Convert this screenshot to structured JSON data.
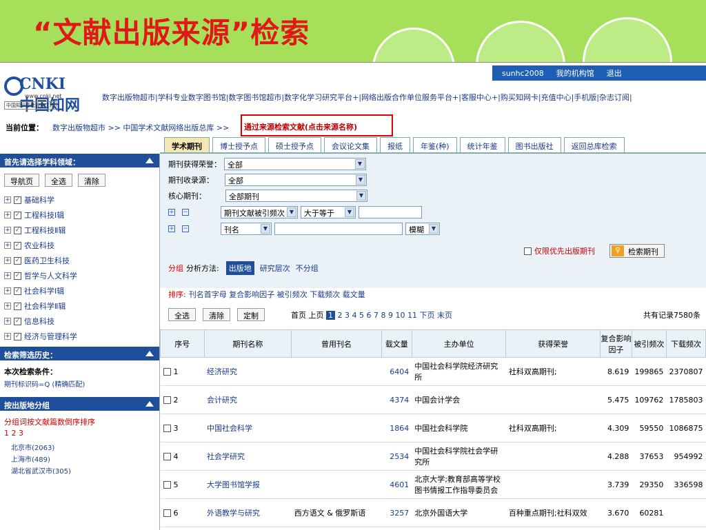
{
  "slide_title": "“文献出版来源”检索",
  "user_bar": {
    "user": "sunhc2008",
    "my_org": "我的机构馆",
    "logout": "退出"
  },
  "logo": {
    "brand": "CNKI中国知网",
    "url": "www.cnki.net",
    "sub": "中国知识基础设施工程"
  },
  "top_links": "数字出版物超市|学科专业数字图书馆|数字图书馆超市|数字化学习研究平台+|网络出版合作单位服务平台+|客服中心+|购买知网卡|充值中心|手机版|杂志订阅|",
  "breadcrumb": {
    "label": "当前位置：",
    "path": "数字出版物超市 >> 中国学术文献网络出版总库 >>",
    "highlight": "通过来源检索文献(点击来源名称)"
  },
  "tabs": [
    "学术期刊",
    "博士授予点",
    "硕士授予点",
    "会议论文集",
    "报纸",
    "年鉴(种)",
    "统计年鉴",
    "图书出版社",
    "返回总库检索"
  ],
  "left": {
    "subject_header": "首先请选择学科领域：",
    "buttons": [
      "导航页",
      "全选",
      "清除"
    ],
    "subjects": [
      "基础科学",
      "工程科技Ⅰ辑",
      "工程科技Ⅱ辑",
      "农业科技",
      "医药卫生科技",
      "哲学与人文科学",
      "社会科学Ⅰ辑",
      "社会科学Ⅱ辑",
      "信息科技",
      "经济与管理科学"
    ],
    "history_header": "检索筛选历史：",
    "cond_label": "本次检索条件：",
    "cond_value": "期刊标识码=Q (精确匹配)",
    "group_header": "按出版地分组",
    "group_sort": "分组词按文献篇数倒序排序",
    "pages": "1 2 3",
    "places": [
      "北京市(2063)",
      "上海市(489)",
      "湖北省武汉市(305)"
    ]
  },
  "filters": {
    "honor_label": "期刊获得荣誉：",
    "honor_value": "全部",
    "source_label": "期刊收录源：",
    "source_value": "全部",
    "core_label": "核心期刊：",
    "core_value": "全部期刊",
    "freq_field": "期刊文献被引频次",
    "freq_op": "大于等于",
    "name_field": "刊名",
    "match_mode": "模糊",
    "priority_label": "仅限优先出版期刊",
    "search_button": "检索期刊"
  },
  "grouping": {
    "label_red": "分组",
    "label": "分析方法:",
    "active": "出版地",
    "opts": [
      "研究层次",
      "不分组"
    ]
  },
  "sorting": {
    "label": "排序:",
    "opts": "刊名首字母 复合影响因子 被引频次 下载频次 载文量"
  },
  "actions": [
    "全选",
    "清除",
    "定制"
  ],
  "pager": {
    "first": "首页",
    "prev": "上页",
    "current": "1",
    "pages": "2 3 4 5 6 7 8 9 10 11",
    "next": "下页",
    "last": "末页"
  },
  "total": "共有记录7580条",
  "table_headers": [
    "序号",
    "期刊名称",
    "曾用刊名",
    "载文量",
    "主办单位",
    "获得荣誉",
    "复合影响因子",
    "被引频次",
    "下载频次"
  ],
  "rows": [
    {
      "n": "1",
      "name": "经济研究",
      "old": "",
      "cnt": "6404",
      "org": "中国社会科学院经济研究所",
      "honor": "社科双高期刊;",
      "if": "8.619",
      "cite": "199865",
      "dl": "2370807"
    },
    {
      "n": "2",
      "name": "会计研究",
      "old": "",
      "cnt": "4374",
      "org": "中国会计学会",
      "honor": "",
      "if": "5.475",
      "cite": "109762",
      "dl": "1785803"
    },
    {
      "n": "3",
      "name": "中国社会科学",
      "old": "",
      "cnt": "1864",
      "org": "中国社会科学院",
      "honor": "社科双高期刊;",
      "if": "4.309",
      "cite": "59550",
      "dl": "1086875"
    },
    {
      "n": "4",
      "name": "社会学研究",
      "old": "",
      "cnt": "2534",
      "org": "中国社会科学院社会学研究所",
      "honor": "",
      "if": "4.288",
      "cite": "37653",
      "dl": "954992"
    },
    {
      "n": "5",
      "name": "大学图书馆学报",
      "old": "",
      "cnt": "4601",
      "org": "北京大学;教育部高等学校图书情报工作指导委员会",
      "honor": "",
      "if": "3.739",
      "cite": "29350",
      "dl": "336598"
    },
    {
      "n": "6",
      "name": "外语教学与研究",
      "old": "西方语文 & 俄罗斯语",
      "cnt": "3257",
      "org": "北京外国语大学",
      "honor": "百种重点期刊;社科双效",
      "if": "3.670",
      "cite": "60281",
      "dl": ""
    }
  ]
}
